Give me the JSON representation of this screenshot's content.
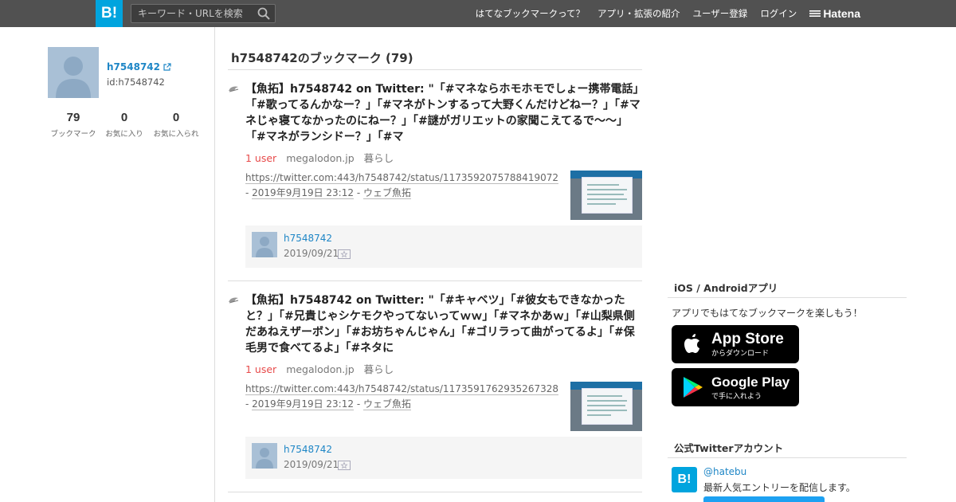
{
  "header": {
    "logo": "B!",
    "search_placeholder": "キーワード・URLを検索",
    "nav": [
      "はてなブックマークって？",
      "アプリ・拡張の紹介",
      "ユーザー登録",
      "ログイン"
    ],
    "brand": "Hatena"
  },
  "profile": {
    "username": "h7548742",
    "userid": "id:h7548742",
    "stats": [
      {
        "value": "79",
        "label": "ブックマーク"
      },
      {
        "value": "0",
        "label": "お気に入り"
      },
      {
        "value": "0",
        "label": "お気に入られ"
      }
    ]
  },
  "main": {
    "title": "h7548742のブックマーク (79)",
    "entries": [
      {
        "title": "【魚拓】h7548742 on Twitter: \"「#マネならホモホモでしょー携帯電話」「#歌ってるんかなー？」「#マネがトンするって大野くんだけどねー？」「#マネじゃ寝てなかったのにねー？」「#謎がガリエットの家聞こえてるで～～」「#マネがランシドー？」「#マ",
        "users": "1 user",
        "domain": "megalodon.jp",
        "category": "暮らし",
        "url": "https://twitter.com:443/h7548742/status/1173592075788419072",
        "sep": " - ",
        "date": "2019年9月19日 23:12",
        "sep2": " - ",
        "source": "ウェブ魚拓",
        "comment_user": "h7548742",
        "comment_date": "2019/09/21"
      },
      {
        "title": "【魚拓】h7548742 on Twitter: \"「#キャベツ」「#彼女もできなかったと？」「#兄貴じゃシケモクやってないってｗｗ」「#マネかあｗ」「#山梨県側だあねえザーボン」「#お坊ちゃんじゃん」「#ゴリラって曲がってるよ」「#保毛男で食べてるよ」「#ネタに",
        "users": "1 user",
        "domain": "megalodon.jp",
        "category": "暮らし",
        "url": "https://twitter.com:443/h7548742/status/1173591762935267328",
        "sep": " - ",
        "date": "2019年9月19日 23:12",
        "sep2": " - ",
        "source": "ウェブ魚拓",
        "comment_user": "h7548742",
        "comment_date": "2019/09/21"
      }
    ]
  },
  "sidebar": {
    "apps_title": "iOS / Androidアプリ",
    "apps_text": "アプリでもはてなブックマークを楽しもう！",
    "appstore_main": "App Store",
    "appstore_sub": "からダウンロード",
    "googleplay_main": "Google Play",
    "googleplay_sub": "で手に入れよう",
    "twitter_title": "公式Twitterアカウント",
    "twitter_logo": "B!",
    "twitter_handle": "@hatebu",
    "twitter_desc": "最新人気エントリーを配信します。"
  },
  "colors": {
    "header_bg": "#515151",
    "brand_blue": "#00a4de",
    "link_blue": "#1e86c6",
    "users_red": "#e74a4a"
  }
}
